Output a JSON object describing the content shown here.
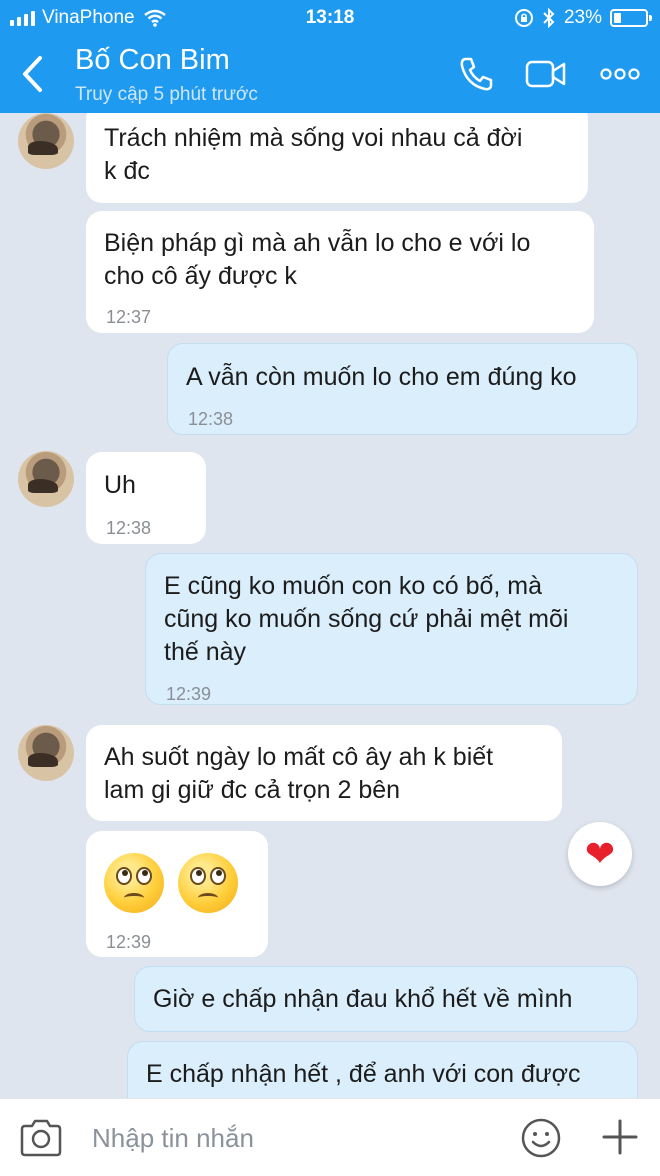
{
  "status_bar": {
    "carrier": "VinaPhone",
    "time": "13:18",
    "battery": "23%",
    "battery_level": 0.23,
    "icons": [
      "signal-icon",
      "wifi-icon",
      "rotation-lock-icon",
      "bluetooth-icon",
      "battery-icon"
    ]
  },
  "header": {
    "title": "Bố Con Bim",
    "subtitle": "Truy cập 5 phút trước",
    "icons": [
      "back-icon",
      "phone-icon",
      "video-icon",
      "more-icon"
    ],
    "accent_color": "#1e9bf0"
  },
  "messages": [
    {
      "side": "in",
      "text": "Trách nhiệm mà sống voi nhau cả đời\nk đc",
      "time": ""
    },
    {
      "side": "in",
      "text": "Biện pháp gì mà ah vẫn lo cho e với lo\ncho cô ấy được k",
      "time": "12:37"
    },
    {
      "side": "out",
      "text": "A vẫn còn muốn lo cho em đúng ko",
      "time": "12:38"
    },
    {
      "side": "in",
      "text": "Uh",
      "time": "12:38"
    },
    {
      "side": "out",
      "text": "E cũng ko muốn con ko có bố, mà\ncũng ko muốn sống cứ phải mệt mõi\nthế này",
      "time": "12:39"
    },
    {
      "side": "in",
      "text": "Ah suốt ngày lo mất cô ây ah k biết\nlam gi giữ đc cả trọn 2 bên",
      "time": ""
    },
    {
      "side": "in",
      "emoji": [
        "confused-eyes-roll-emoji",
        "confused-eyes-roll-emoji"
      ],
      "time": "12:39"
    },
    {
      "side": "out",
      "text": "Giờ e chấp nhận đau khổ hết về mình",
      "time": ""
    },
    {
      "side": "out",
      "text": "E chấp nhận hết , để anh với con được",
      "time": ""
    }
  ],
  "reaction": {
    "icon": "heart-icon",
    "glyph": "❤",
    "color": "#e8202c"
  },
  "composer": {
    "placeholder": "Nhập tin nhắn",
    "icons": [
      "camera-icon",
      "smile-icon",
      "plus-icon"
    ]
  }
}
